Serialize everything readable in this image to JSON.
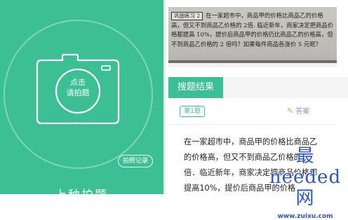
{
  "left_panel": {
    "camera_button_line1": "点击",
    "camera_button_line2": "请拍题",
    "history_button": "拍照记录",
    "bottom_title": "上种拍题",
    "bg_color": "#3dbf94"
  },
  "right_panel": {
    "photo": {
      "tag": "巩固练习 2",
      "text": "在一家超市中，商品甲的价格比商品乙的价格高，但又不到商品乙价格的 2倍. 临近新年，商家决定把商品价格都提高 10%，提价后商品甲的价格仍比商品乙的价格高，但不到商品乙价格的 2 倍吗？如果每件商品各涨价 5 元呢？"
    },
    "result_label": "搜题结果",
    "question_tag": "第1题",
    "answer_link": "答案",
    "answer_icon": "edit-icon",
    "question_text": "在一家超市中，商品甲的价格比商品乙的价格高，但又不到商品乙价格的2倍．临近新年，商家决定把商品价格都提高10%，提价后商品甲的价格",
    "accent_color": "#3dbf94"
  },
  "watermark": {
    "text": "最needed网",
    "url": "www.zuixu.com"
  }
}
